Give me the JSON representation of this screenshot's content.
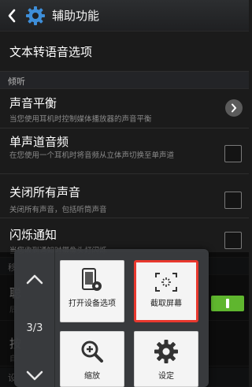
{
  "app_bar": {
    "title": "辅助功能"
  },
  "items": {
    "tts": {
      "title": "文本转语音选项"
    },
    "sound_balance": {
      "title": "声音平衡",
      "subtitle": "当您使用耳机时控制媒体播放器的声音平衡"
    },
    "mono_audio": {
      "title": "单声道音频",
      "subtitle": "在您使用一个耳机时将音频从立体声切换至单声道"
    },
    "mute_all": {
      "title": "关闭所有声音",
      "subtitle": "关闭所有声音，包括听筒声音"
    },
    "flash": {
      "title": "闪烁通知",
      "subtitle": "当您收到通知时摄像头灯闪烁"
    },
    "partial_1": {
      "title": "聪",
      "subtitle": "后"
    },
    "partial_2": {
      "title": "按",
      "subtitle": "自"
    },
    "partial_section": {
      "label": "移"
    },
    "partial_bottom": {
      "label": "设"
    }
  },
  "sections": {
    "hearing": "倾听"
  },
  "panel": {
    "page_indicator": "3/3",
    "tiles": [
      {
        "label": "打开设备选项",
        "icon": "device-options-icon"
      },
      {
        "label": "截取屏幕",
        "icon": "screenshot-icon"
      },
      {
        "label": "缩放",
        "icon": "zoom-icon"
      },
      {
        "label": "设定",
        "icon": "settings-icon"
      }
    ]
  },
  "colors": {
    "toggle_on": "#5fb62e",
    "highlight": "#e8382e",
    "accent": "#3e8ed8"
  }
}
